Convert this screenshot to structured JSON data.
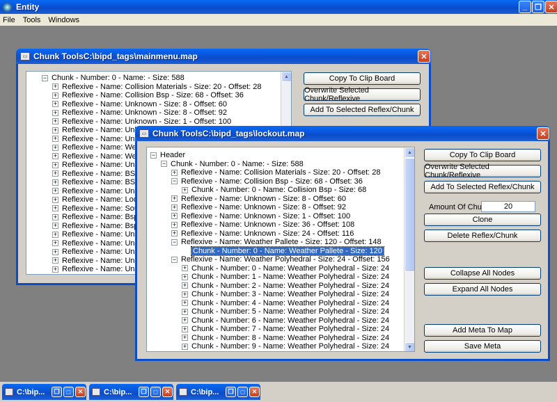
{
  "app": {
    "title": "Entity"
  },
  "menu": [
    "File",
    "Tools",
    "Windows"
  ],
  "win1": {
    "title": "Chunk ToolsC:\\bipd_tags\\mainmenu.map",
    "nodes": [
      {
        "t": "Chunk - Number: 0 - Name:  - Size: 588",
        "l": 1,
        "e": "-"
      },
      {
        "t": "Reflexive - Name: Collision Materials - Size: 20 - Offset: 28",
        "l": 2,
        "e": "+"
      },
      {
        "t": "Reflexive - Name: Collision Bsp - Size: 68 - Offset: 36",
        "l": 2,
        "e": "+"
      },
      {
        "t": "Reflexive - Name: Unknown - Size: 8 - Offset: 60",
        "l": 2,
        "e": "+"
      },
      {
        "t": "Reflexive - Name: Unknown - Size: 8 - Offset: 92",
        "l": 2,
        "e": "+"
      },
      {
        "t": "Reflexive - Name: Unknown - Size: 1 - Offset: 100",
        "l": 2,
        "e": "+"
      },
      {
        "t": "Reflexive - Name: Unknown",
        "l": 2,
        "e": "+"
      },
      {
        "t": "Reflexive - Name: Unknown",
        "l": 2,
        "e": "+"
      },
      {
        "t": "Reflexive - Name: Weather F",
        "l": 2,
        "e": "+"
      },
      {
        "t": "Reflexive - Name: Weather F",
        "l": 2,
        "e": "+"
      },
      {
        "t": "Reflexive - Name: Unknown",
        "l": 2,
        "e": "+"
      },
      {
        "t": "Reflexive - Name: BSP Mode",
        "l": 2,
        "e": "+"
      },
      {
        "t": "Reflexive - Name: BSP Textu",
        "l": 2,
        "e": "+"
      },
      {
        "t": "Reflexive - Name: Unknown",
        "l": 2,
        "e": "+"
      },
      {
        "t": "Reflexive - Name: Looping S",
        "l": 2,
        "e": "+"
      },
      {
        "t": "Reflexive - Name: Sound En",
        "l": 2,
        "e": "+"
      },
      {
        "t": "Reflexive - Name: Bsp Perm",
        "l": 2,
        "e": "+"
      },
      {
        "t": "Reflexive - Name: Bsp Scen",
        "l": 2,
        "e": "+"
      },
      {
        "t": "Reflexive - Name: Unknown",
        "l": 2,
        "e": "+"
      },
      {
        "t": "Reflexive - Name: Unknown",
        "l": 2,
        "e": "+"
      },
      {
        "t": "Reflexive - Name: Unknown",
        "l": 2,
        "e": "+"
      },
      {
        "t": "Reflexive - Name: Unknown",
        "l": 2,
        "e": "+"
      },
      {
        "t": "Reflexive - Name: Unknown",
        "l": 2,
        "e": "+"
      }
    ],
    "buttons": [
      "Copy To Clip Board",
      "Overwrite Selected Chunk/Reflexive",
      "Add To Selected Reflex/Chunk"
    ]
  },
  "win2": {
    "title": "Chunk ToolsC:\\bipd_tags\\lockout.map",
    "nodes": [
      {
        "t": "Header",
        "l": 0,
        "e": "-"
      },
      {
        "t": "Chunk - Number: 0 - Name:  - Size: 588",
        "l": 1,
        "e": "-"
      },
      {
        "t": "Reflexive - Name: Collision Materials - Size: 20 - Offset: 28",
        "l": 2,
        "e": "+"
      },
      {
        "t": "Reflexive - Name: Collision Bsp - Size: 68 - Offset: 36",
        "l": 2,
        "e": "-"
      },
      {
        "t": "Chunk - Number: 0 - Name: Collision Bsp - Size: 68",
        "l": 3,
        "e": "+"
      },
      {
        "t": "Reflexive - Name: Unknown - Size: 8 - Offset: 60",
        "l": 2,
        "e": "+"
      },
      {
        "t": "Reflexive - Name: Unknown - Size: 8 - Offset: 92",
        "l": 2,
        "e": "+"
      },
      {
        "t": "Reflexive - Name: Unknown - Size: 1 - Offset: 100",
        "l": 2,
        "e": "+"
      },
      {
        "t": "Reflexive - Name: Unknown - Size: 36 - Offset: 108",
        "l": 2,
        "e": "+"
      },
      {
        "t": "Reflexive - Name: Unknown - Size: 24 - Offset: 116",
        "l": 2,
        "e": "+"
      },
      {
        "t": "Reflexive - Name: Weather Pallete - Size: 120 - Offset: 148",
        "l": 2,
        "e": "-"
      },
      {
        "t": "Chunk - Number: 0 - Name: Weather Pallete - Size: 120",
        "l": 3,
        "e": "",
        "sel": true
      },
      {
        "t": "Reflexive - Name: Weather Polyhedral - Size: 24 - Offset: 156",
        "l": 2,
        "e": "-"
      },
      {
        "t": "Chunk - Number: 0 - Name: Weather Polyhedral - Size: 24",
        "l": 3,
        "e": "+"
      },
      {
        "t": "Chunk - Number: 1 - Name: Weather Polyhedral - Size: 24",
        "l": 3,
        "e": "+"
      },
      {
        "t": "Chunk - Number: 2 - Name: Weather Polyhedral - Size: 24",
        "l": 3,
        "e": "+"
      },
      {
        "t": "Chunk - Number: 3 - Name: Weather Polyhedral - Size: 24",
        "l": 3,
        "e": "+"
      },
      {
        "t": "Chunk - Number: 4 - Name: Weather Polyhedral - Size: 24",
        "l": 3,
        "e": "+"
      },
      {
        "t": "Chunk - Number: 5 - Name: Weather Polyhedral - Size: 24",
        "l": 3,
        "e": "+"
      },
      {
        "t": "Chunk - Number: 6 - Name: Weather Polyhedral - Size: 24",
        "l": 3,
        "e": "+"
      },
      {
        "t": "Chunk - Number: 7 - Name: Weather Polyhedral - Size: 24",
        "l": 3,
        "e": "+"
      },
      {
        "t": "Chunk - Number: 8 - Name: Weather Polyhedral - Size: 24",
        "l": 3,
        "e": "+"
      },
      {
        "t": "Chunk - Number: 9 - Name: Weather Polyhedral - Size: 24",
        "l": 3,
        "e": "+"
      }
    ],
    "buttons": {
      "copy": "Copy To Clip Board",
      "overwrite": "Overwrite Selected Chunk/Reflexive",
      "add": "Add To Selected Reflex/Chunk",
      "amount_label": "Amount Of Chunks:",
      "amount_value": "20",
      "clone": "Clone",
      "delete": "Delete Reflex/Chunk",
      "collapse": "Collapse All Nodes",
      "expand": "Expand All Nodes",
      "addmeta": "Add Meta To Map",
      "save": "Save Meta"
    }
  },
  "taskbar": [
    "C:\\bip...",
    "C:\\bip...",
    "C:\\bip..."
  ]
}
